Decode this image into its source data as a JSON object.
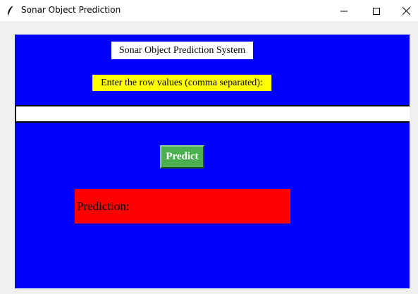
{
  "window": {
    "title": "Sonar Object Prediction",
    "icon": "feather-icon"
  },
  "app": {
    "heading": "Sonar Object Prediction System",
    "input_label": "Enter the row values (comma separated):",
    "input_value": "",
    "predict_label": "Predict",
    "result_label": "Prediction:"
  },
  "colors": {
    "canvas": "#0000ff",
    "label_highlight": "#ffff00",
    "button": "#4caf50",
    "result_box": "#ff0000"
  }
}
